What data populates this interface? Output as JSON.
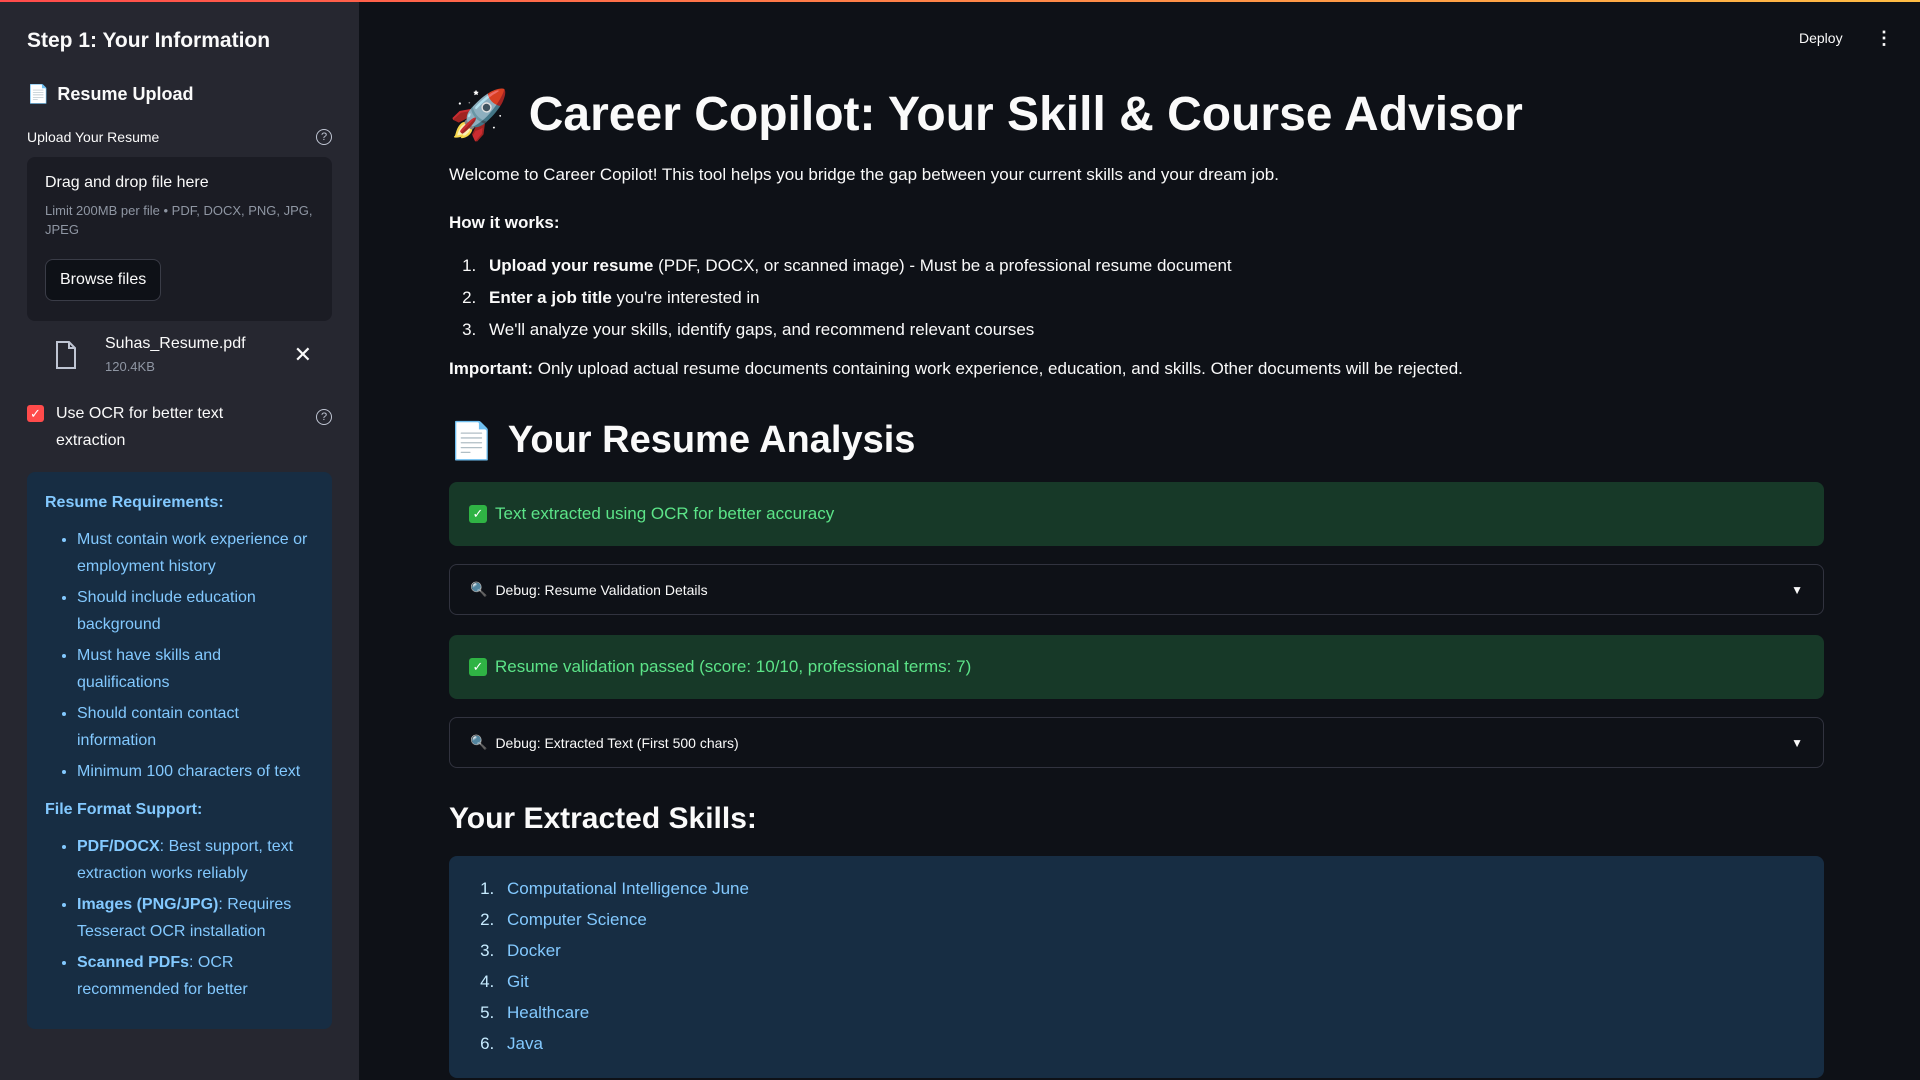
{
  "sidebar": {
    "title": "Step 1: Your Information",
    "resume_upload_heading": "Resume Upload",
    "upload_label": "Upload Your Resume",
    "dropzone": {
      "title": "Drag and drop file here",
      "limit": "Limit 200MB per file • PDF, DOCX, PNG, JPG, JPEG",
      "browse_button": "Browse files"
    },
    "file": {
      "name": "Suhas_Resume.pdf",
      "size": "120.4KB"
    },
    "ocr_checkbox": {
      "label": "Use OCR for better text extraction",
      "checked": true
    },
    "requirements": {
      "heading": "Resume Requirements:",
      "items": [
        "Must contain work experience or employment history",
        "Should include education background",
        "Must have skills and qualifications",
        "Should contain contact information",
        "Minimum 100 characters of text"
      ]
    },
    "formats": {
      "heading": "File Format Support:",
      "items": [
        {
          "name": "PDF/DOCX",
          "desc": ": Best support, text extraction works reliably"
        },
        {
          "name": "Images (PNG/JPG)",
          "desc": ": Requires Tesseract OCR installation"
        },
        {
          "name": "Scanned PDFs",
          "desc": ": OCR recommended for better"
        }
      ]
    }
  },
  "header": {
    "deploy": "Deploy",
    "menu_icon": "⋮"
  },
  "main": {
    "title": "Career Copilot: Your Skill & Course Advisor",
    "title_icon": "🚀",
    "welcome": "Welcome to Career Copilot! This tool helps you bridge the gap between your current skills and your dream job.",
    "how_it_works": "How it works:",
    "steps": [
      {
        "bold": "Upload your resume",
        "rest": " (PDF, DOCX, or scanned image) - Must be a professional resume document"
      },
      {
        "bold": "Enter a job title",
        "rest": " you're interested in"
      },
      {
        "bold": "",
        "rest": "We'll analyze your skills, identify gaps, and recommend relevant courses"
      }
    ],
    "important_label": "Important:",
    "important_text": " Only upload actual resume documents containing work experience, education, and skills. Other documents will be rejected.",
    "analysis_heading": "Your Resume Analysis",
    "analysis_icon": "📄",
    "ocr_success": "Text extracted using OCR for better accuracy",
    "debug_validation": "Debug: Resume Validation Details",
    "validation_success": "Resume validation passed (score: 10/10, professional terms: 7)",
    "debug_extracted": "Debug: Extracted Text (First 500 chars)",
    "skills_heading": "Your Extracted Skills:",
    "skills": [
      "Computational Intelligence June",
      "Computer Science",
      "Docker",
      "Git",
      "Healthcare",
      "Java"
    ]
  },
  "colors": {
    "accent": "#ff4b4b",
    "success_bg": "#173928",
    "info_bg": "#172d43"
  }
}
